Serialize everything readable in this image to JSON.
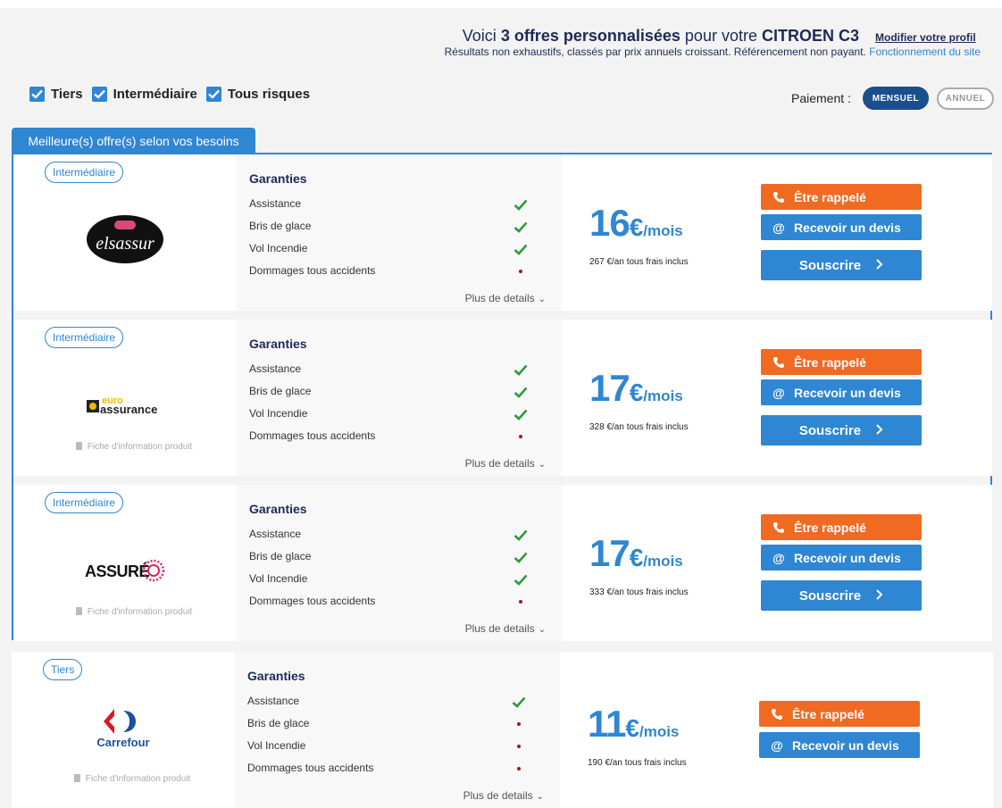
{
  "header": {
    "intro": "Voici",
    "count": "3 offres personnalisées",
    "for_text": "pour votre",
    "vehicle": "CITROEN C3",
    "modify_link": "Modifier votre profil",
    "subtitle": "Résultats non exhaustifs, classés par prix annuels croissant. Référencement non payant.",
    "how_link": "Fonctionnement du site"
  },
  "filters": [
    {
      "label": "Tiers",
      "checked": true
    },
    {
      "label": "Intermédiaire",
      "checked": true
    },
    {
      "label": "Tous risques",
      "checked": true
    }
  ],
  "payment": {
    "label": "Paiement :",
    "monthly": "MENSUEL",
    "annual": "ANNUEL",
    "selected": "MENSUEL"
  },
  "best_tab": "Meilleure(s) offre(s) selon vos besoins",
  "common": {
    "guarantees_title": "Garanties",
    "more_details": "Plus de details",
    "call_btn": "Être rappelé",
    "quote_btn": "Recevoir un devis",
    "subscribe_btn": "Souscrire",
    "fiche": "Fiche d'information produit"
  },
  "colors": {
    "accent": "#2f86d3",
    "orange": "#f06a22",
    "navy": "#1d2a57",
    "check": "#2e9b3d",
    "cross": "#9b1b1b"
  },
  "offers": [
    {
      "coverage": "Intermédiaire",
      "insurer": "elsassur",
      "price": "16",
      "currency": "€",
      "period": "/mois",
      "annual": "267 €/an tous frais inclus",
      "guarantees": [
        {
          "name": "Assistance",
          "included": true
        },
        {
          "name": "Bris de glace",
          "included": true
        },
        {
          "name": "Vol Incendie",
          "included": true
        },
        {
          "name": "Dommages tous accidents",
          "included": false
        }
      ]
    },
    {
      "coverage": "Intermédiaire",
      "insurer": "euro assurance",
      "price": "17",
      "currency": "€",
      "period": "/mois",
      "annual": "328 €/an tous frais inclus",
      "guarantees": [
        {
          "name": "Assistance",
          "included": true
        },
        {
          "name": "Bris de glace",
          "included": true
        },
        {
          "name": "Vol Incendie",
          "included": true
        },
        {
          "name": "Dommages tous accidents",
          "included": false
        }
      ]
    },
    {
      "coverage": "Intermédiaire",
      "insurer": "ASSURÉO",
      "price": "17",
      "currency": "€",
      "period": "/mois",
      "annual": "333 €/an tous frais inclus",
      "guarantees": [
        {
          "name": "Assistance",
          "included": true
        },
        {
          "name": "Bris de glace",
          "included": true
        },
        {
          "name": "Vol Incendie",
          "included": true
        },
        {
          "name": "Dommages tous accidents",
          "included": false
        }
      ]
    },
    {
      "coverage": "Tiers",
      "insurer": "Carrefour",
      "price": "11",
      "currency": "€",
      "period": "/mois",
      "annual": "190 €/an tous frais inclus",
      "guarantees": [
        {
          "name": "Assistance",
          "included": true
        },
        {
          "name": "Bris de glace",
          "included": false
        },
        {
          "name": "Vol Incendie",
          "included": false
        },
        {
          "name": "Dommages tous accidents",
          "included": false
        }
      ]
    }
  ]
}
